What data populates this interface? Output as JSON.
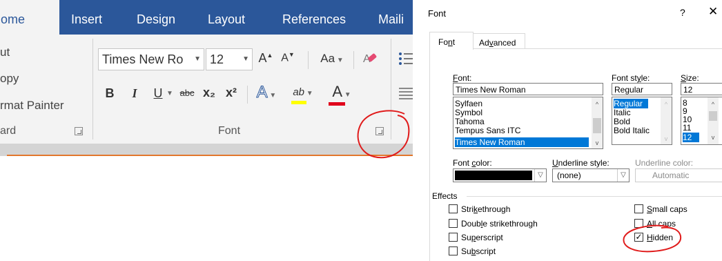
{
  "ribbon": {
    "tabs": [
      {
        "label": "Home"
      },
      {
        "label": "Insert"
      },
      {
        "label": "Design"
      },
      {
        "label": "Layout"
      },
      {
        "label": "References"
      },
      {
        "label": "Maili"
      }
    ],
    "clipboard": {
      "cut": "ut",
      "copy": "opy",
      "format_painter": "rmat Painter",
      "group_label": "ard"
    },
    "font_group": {
      "font_name": "Times New Ro",
      "font_size": "12",
      "grow_font": "A",
      "shrink_font": "A",
      "change_case": "Aa",
      "bold": "B",
      "italic": "I",
      "underline": "U",
      "strikethrough": "abc",
      "subscript": "x₂",
      "superscript": "x²",
      "text_effects": "A",
      "highlight": "ab",
      "font_color": "A",
      "group_label": "Font"
    }
  },
  "dialog": {
    "title": "Font",
    "help": "?",
    "close": "✕",
    "tabs": [
      {
        "label": "Font",
        "active": true
      },
      {
        "label": "Advanced",
        "active": false
      }
    ],
    "font": {
      "label": "Font:",
      "value": "Times New Roman",
      "list": [
        "Sylfaen",
        "Symbol",
        "Tahoma",
        "Tempus Sans ITC",
        "Times New Roman"
      ],
      "selected": "Times New Roman"
    },
    "font_style": {
      "label": "Font style:",
      "value": "Regular",
      "list": [
        "Regular",
        "Italic",
        "Bold",
        "Bold Italic"
      ],
      "selected": "Regular"
    },
    "size": {
      "label": "Size:",
      "value": "12",
      "list": [
        "8",
        "9",
        "10",
        "11",
        "12"
      ],
      "selected": "12"
    },
    "font_color": {
      "label": "Font color:",
      "value": "#000000"
    },
    "underline_style": {
      "label": "Underline style:",
      "value": "(none)"
    },
    "underline_color": {
      "label": "Underline color:",
      "value": "Automatic"
    },
    "effects": {
      "label": "Effects",
      "items": [
        {
          "label": "Strikethrough",
          "checked": false
        },
        {
          "label": "Double strikethrough",
          "checked": false
        },
        {
          "label": "Superscript",
          "checked": false
        },
        {
          "label": "Subscript",
          "checked": false
        },
        {
          "label": "Small caps",
          "checked": false
        },
        {
          "label": "All caps",
          "checked": false
        },
        {
          "label": "Hidden",
          "checked": true
        }
      ]
    }
  },
  "colors": {
    "ribbon_blue": "#2b579a",
    "ribbon_bg": "#f3f3f3",
    "selection_blue": "#0078d7",
    "annotation_red": "#e01b1b",
    "highlight_yellow": "#ffff00",
    "font_color_red": "#e0001b"
  }
}
